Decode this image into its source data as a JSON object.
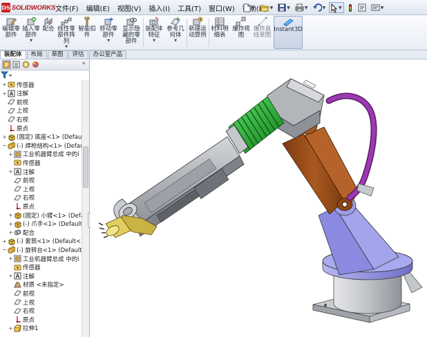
{
  "app": {
    "logo_text": "SOLIDWORKS",
    "logo_badge": "DS",
    "brand_color": "#c8201e"
  },
  "menu": [
    "文件(F)",
    "编辑(E)",
    "视图(V)",
    "插入(I)",
    "工具(T)",
    "窗口(W)",
    "帮助(H)"
  ],
  "quick_access": [
    "new-icon",
    "open-icon",
    "save-icon",
    "print-icon",
    "undo-icon",
    "select-icon",
    "rebuild-icon",
    "file-properties-icon",
    "options-icon"
  ],
  "ribbon": {
    "buttons": [
      {
        "id": "edit-component",
        "label": "编辑零\n部件",
        "icon": "edit-component-icon"
      },
      {
        "id": "insert-component",
        "label": "插入零\n部件",
        "icon": "insert-component-icon"
      },
      {
        "id": "mate",
        "label": "配合",
        "icon": "mate-icon"
      },
      {
        "id": "linear-pattern",
        "label": "线性零\n部件阵\n列",
        "icon": "linear-pattern-icon"
      },
      {
        "id": "smart-fasteners",
        "label": "智能扣\n件",
        "icon": "smart-fasteners-icon"
      },
      {
        "id": "move-component",
        "label": "移动零\n部件",
        "icon": "move-component-icon"
      },
      {
        "id": "show-hidden",
        "label": "显示隐\n藏的零\n部件",
        "icon": "show-hidden-icon"
      },
      {
        "id": "assembly-features",
        "label": "装配体\n特征",
        "icon": "assembly-features-icon"
      },
      {
        "id": "reference-geometry",
        "label": "参考几\n何体",
        "icon": "reference-geometry-icon"
      },
      {
        "id": "new-motion-study",
        "label": "新建运\n动算例",
        "icon": "motion-study-icon"
      },
      {
        "id": "bill-of-materials",
        "label": "材料明\n细表",
        "icon": "bom-icon"
      },
      {
        "id": "exploded-view",
        "label": "爆炸视\n图",
        "icon": "exploded-view-icon"
      },
      {
        "id": "explode-line-sketch",
        "label": "爆炸直\n线草图",
        "icon": "explode-line-icon"
      },
      {
        "id": "instant3d",
        "label": "Instant3D",
        "icon": "instant3d-icon"
      }
    ]
  },
  "tabs": [
    "装配体",
    "布局",
    "草图",
    "评估",
    "办公室产品"
  ],
  "panel": {
    "tool_icons": [
      "feature-manager-icon",
      "property-manager-icon",
      "configuration-manager-icon",
      "display-manager-icon"
    ],
    "expand_label": "»"
  },
  "tree": [
    {
      "indent": 0,
      "exp": "+",
      "icon": "sensor-icon",
      "text": "传感器"
    },
    {
      "indent": 0,
      "exp": "+",
      "icon": "annotation-icon",
      "text": "注解"
    },
    {
      "indent": 0,
      "exp": "",
      "icon": "plane-icon",
      "text": "前视"
    },
    {
      "indent": 0,
      "exp": "",
      "icon": "plane-icon",
      "text": "上视"
    },
    {
      "indent": 0,
      "exp": "",
      "icon": "plane-icon",
      "text": "右视"
    },
    {
      "indent": 0,
      "exp": "",
      "icon": "origin-icon",
      "text": "原点"
    },
    {
      "indent": 0,
      "exp": "+",
      "icon": "part-icon",
      "text": "(固定) 底座<1> (Default"
    },
    {
      "indent": 0,
      "exp": "−",
      "icon": "subassembly-icon",
      "text": "(-) 焊枪结构<1> (Default"
    },
    {
      "indent": 1,
      "exp": "+",
      "icon": "history-icon",
      "text": "工业机器臂总成 中的i"
    },
    {
      "indent": 1,
      "exp": "",
      "icon": "sensor-icon",
      "text": "传感器"
    },
    {
      "indent": 1,
      "exp": "+",
      "icon": "annotation-icon",
      "text": "注解"
    },
    {
      "indent": 1,
      "exp": "",
      "icon": "plane-icon",
      "text": "前视"
    },
    {
      "indent": 1,
      "exp": "",
      "icon": "plane-icon",
      "text": "上视"
    },
    {
      "indent": 1,
      "exp": "",
      "icon": "plane-icon",
      "text": "右视"
    },
    {
      "indent": 1,
      "exp": "",
      "icon": "origin-icon",
      "text": "原点"
    },
    {
      "indent": 1,
      "exp": "+",
      "icon": "part-icon",
      "text": "(固定) 小臂<1> (Defa"
    },
    {
      "indent": 1,
      "exp": "+",
      "icon": "part-icon",
      "text": "(-) 爪手<1> (Default"
    },
    {
      "indent": 1,
      "exp": "+",
      "icon": "mates-icon",
      "text": "配合"
    },
    {
      "indent": 0,
      "exp": "+",
      "icon": "part-icon",
      "text": "(-) 套筒<1> (Default<<"
    },
    {
      "indent": 0,
      "exp": "−",
      "icon": "subassembly-icon",
      "text": "(-) 旋转台<1> (Default-"
    },
    {
      "indent": 1,
      "exp": "+",
      "icon": "history-icon",
      "text": "工业机器臂总成 中的i"
    },
    {
      "indent": 1,
      "exp": "",
      "icon": "sensor-icon",
      "text": "传感器"
    },
    {
      "indent": 1,
      "exp": "+",
      "icon": "annotation-icon",
      "text": "注解"
    },
    {
      "indent": 1,
      "exp": "",
      "icon": "material-icon",
      "text": "材质 <未指定>"
    },
    {
      "indent": 1,
      "exp": "",
      "icon": "plane-icon",
      "text": "前视"
    },
    {
      "indent": 1,
      "exp": "",
      "icon": "plane-icon",
      "text": "上视"
    },
    {
      "indent": 1,
      "exp": "",
      "icon": "plane-icon",
      "text": "右视"
    },
    {
      "indent": 1,
      "exp": "",
      "icon": "origin-icon",
      "text": "原点"
    },
    {
      "indent": 1,
      "exp": "+",
      "icon": "extrude-icon",
      "text": "拉伸1"
    }
  ],
  "colors": {
    "arm_grey": "#a9adb3",
    "bracket_brown": "#a0521d",
    "spring_green": "#1fae2a",
    "hose_purple": "#8a2c9c",
    "base_lavender": "#9b9be6",
    "gun_tip_gold": "#c8b040"
  }
}
